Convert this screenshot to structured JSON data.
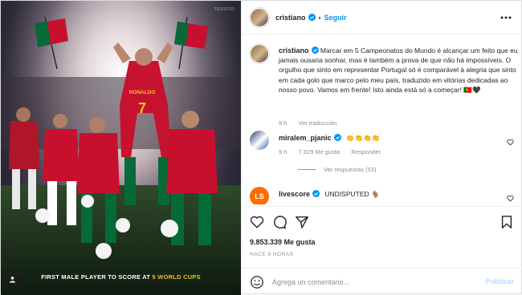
{
  "media": {
    "caption_prefix": "FIRST MALE PLAYER TO SCORE AT ",
    "caption_highlight": "5 WORLD CUPS",
    "watermark": "TESOTO",
    "jersey_text": "RONALDO",
    "jersey_number": "7"
  },
  "header": {
    "username": "cristiano",
    "separator": "•",
    "follow_label": "Seguir",
    "more_icon": "ellipsis-icon"
  },
  "post": {
    "username": "cristiano",
    "caption": "Marcar em 5 Campeonatos do Mundo é alcançar um feito que eu jamais ousaria sonhar, mas é também a prova de que não há impossíveis. O orgulho que sinto em representar Portugal só é comparável à alegria que sinto em cada golo que marco pelo meu país, traduzido em vitórias dedicadas ao nosso povo. Vamos em frente! Isto ainda está só a começar! 🇵🇹🖤",
    "time": "9 h",
    "translate_label": "Ver traducción"
  },
  "comments": [
    {
      "username": "miralem_pjanic",
      "text": "👏👏👏👏",
      "time": "9 h",
      "likes": "7.329 Me gusta",
      "reply_label": "Responder"
    },
    {
      "username": "livescore",
      "text": "UNDISPUTED 🐐"
    }
  ],
  "view_replies_label": "Ver respuestas (53)",
  "likes_count": "9.853.339 Me gusta",
  "timestamp": "HACE 9 HORAS",
  "composer": {
    "placeholder": "Agrega un comentario...",
    "publish_label": "Publicar"
  },
  "colors": {
    "accent": "#0095f6",
    "publish_disabled": "#b3dbff",
    "muted": "#8e8e8e",
    "portugal_red": "#c8102e",
    "portugal_green": "#046a38"
  }
}
